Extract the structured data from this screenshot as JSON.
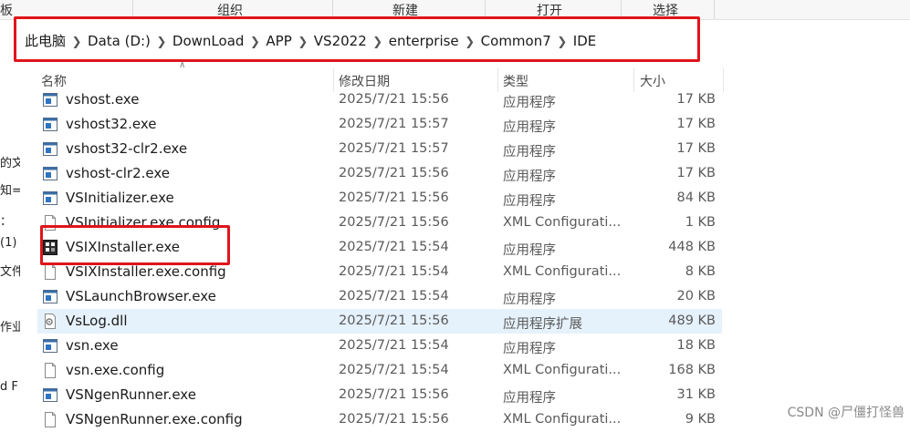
{
  "ribbon": {
    "groups": [
      "板",
      "组织",
      "新建",
      "打开",
      "选择"
    ]
  },
  "address": {
    "crumbs": [
      "此电脑",
      "Data (D:)",
      "DownLoad",
      "APP",
      "VS2022",
      "enterprise",
      "Common7",
      "IDE"
    ]
  },
  "leftnav": [
    "的文",
    "知=",
    "：",
    "(1)",
    "文件夹",
    "作业",
    "d F"
  ],
  "columns": {
    "name": "名称",
    "date": "修改日期",
    "type": "类型",
    "size": "大小"
  },
  "files": [
    {
      "name": "vshost.exe",
      "date": "2025/7/21 15:56",
      "type": "应用程序",
      "size": "17 KB",
      "icon": "exe-window-icon"
    },
    {
      "name": "vshost32.exe",
      "date": "2025/7/21 15:57",
      "type": "应用程序",
      "size": "17 KB",
      "icon": "exe-window-icon"
    },
    {
      "name": "vshost32-clr2.exe",
      "date": "2025/7/21 15:57",
      "type": "应用程序",
      "size": "17 KB",
      "icon": "exe-window-icon"
    },
    {
      "name": "vshost-clr2.exe",
      "date": "2025/7/21 15:56",
      "type": "应用程序",
      "size": "17 KB",
      "icon": "exe-window-icon"
    },
    {
      "name": "VSInitializer.exe",
      "date": "2025/7/21 15:56",
      "type": "应用程序",
      "size": "84 KB",
      "icon": "exe-window-icon"
    },
    {
      "name": "VSInitializer.exe.config",
      "date": "2025/7/21 15:56",
      "type": "XML Configurati...",
      "size": "1 KB",
      "icon": "document-icon"
    },
    {
      "name": "VSIXInstaller.exe",
      "date": "2025/7/21 15:54",
      "type": "应用程序",
      "size": "448 KB",
      "icon": "vsix-installer-icon"
    },
    {
      "name": "VSIXInstaller.exe.config",
      "date": "2025/7/21 15:54",
      "type": "XML Configurati...",
      "size": "8 KB",
      "icon": "document-icon"
    },
    {
      "name": "VSLaunchBrowser.exe",
      "date": "2025/7/21 15:54",
      "type": "应用程序",
      "size": "20 KB",
      "icon": "exe-window-icon"
    },
    {
      "name": "VsLog.dll",
      "date": "2025/7/21 15:56",
      "type": "应用程序扩展",
      "size": "489 KB",
      "icon": "dll-gear-icon",
      "selected": true
    },
    {
      "name": "vsn.exe",
      "date": "2025/7/21 15:54",
      "type": "应用程序",
      "size": "18 KB",
      "icon": "exe-window-icon"
    },
    {
      "name": "vsn.exe.config",
      "date": "2025/7/21 15:54",
      "type": "XML Configurati...",
      "size": "168 KB",
      "icon": "document-icon"
    },
    {
      "name": "VSNgenRunner.exe",
      "date": "2025/7/21 15:56",
      "type": "应用程序",
      "size": "31 KB",
      "icon": "exe-window-icon"
    },
    {
      "name": "VSNgenRunner.exe.config",
      "date": "2025/7/21 15:56",
      "type": "XML Configurati...",
      "size": "9 KB",
      "icon": "document-icon"
    }
  ],
  "watermark": "CSDN @尸僵打怪兽",
  "colors": {
    "highlight": "#e0141b",
    "selected_row": "#e5f1fb"
  }
}
